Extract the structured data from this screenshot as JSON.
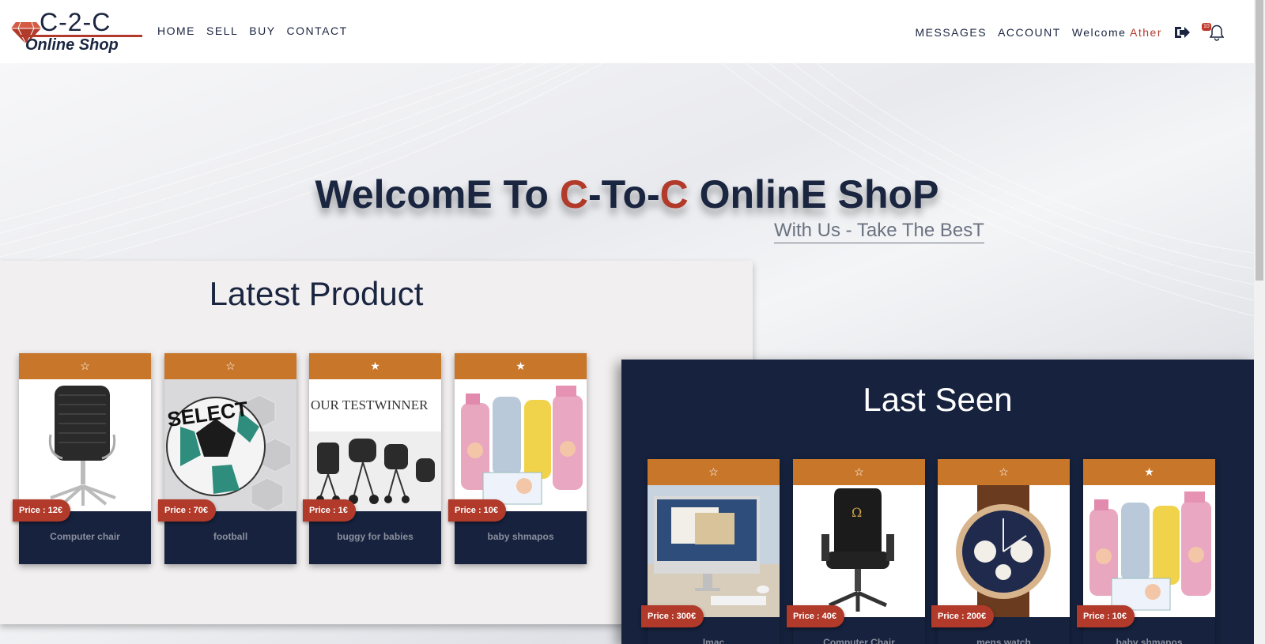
{
  "brand": {
    "logo_top": "C-2-C",
    "logo_bottom": "Online Shop"
  },
  "nav": {
    "left": [
      "HOME",
      "SELL",
      "BUY",
      "CONTACT"
    ],
    "messages": "MESSAGES",
    "account": "ACCOUNT",
    "welcome": "Welcome",
    "user": "Ather",
    "notifications": "10"
  },
  "hero": {
    "title_a": "WelcomE To ",
    "title_c1": "C",
    "title_b": "-To-",
    "title_c2": "C",
    "title_c": " OnlinE ShoP",
    "subtitle": "With Us - Take The BesT"
  },
  "latest": {
    "heading": "Latest Product",
    "items": [
      {
        "name": "Computer chair",
        "price": "Price : 12€",
        "star": "☆"
      },
      {
        "name": "football",
        "price": "Price : 70€",
        "star": "☆"
      },
      {
        "name": "buggy for babies",
        "price": "Price : 1€",
        "star": "★"
      },
      {
        "name": "baby shmapos",
        "price": "Price : 10€",
        "star": "★"
      }
    ]
  },
  "last_seen": {
    "heading": "Last Seen",
    "items": [
      {
        "name": "Imac",
        "price": "Price : 300€",
        "star": "☆"
      },
      {
        "name": "Computer Chair",
        "price": "Price : 40€",
        "star": "☆"
      },
      {
        "name": "mens watch",
        "price": "Price : 200€",
        "star": "☆"
      },
      {
        "name": "baby shmapos",
        "price": "Price : 10€",
        "star": "★"
      }
    ]
  },
  "colors": {
    "navy": "#16223e",
    "orange": "#c8762a",
    "red": "#b23a2a"
  },
  "icons": {
    "logout": "logout-icon",
    "bell": "bell-icon",
    "gem": "diamond-icon"
  }
}
